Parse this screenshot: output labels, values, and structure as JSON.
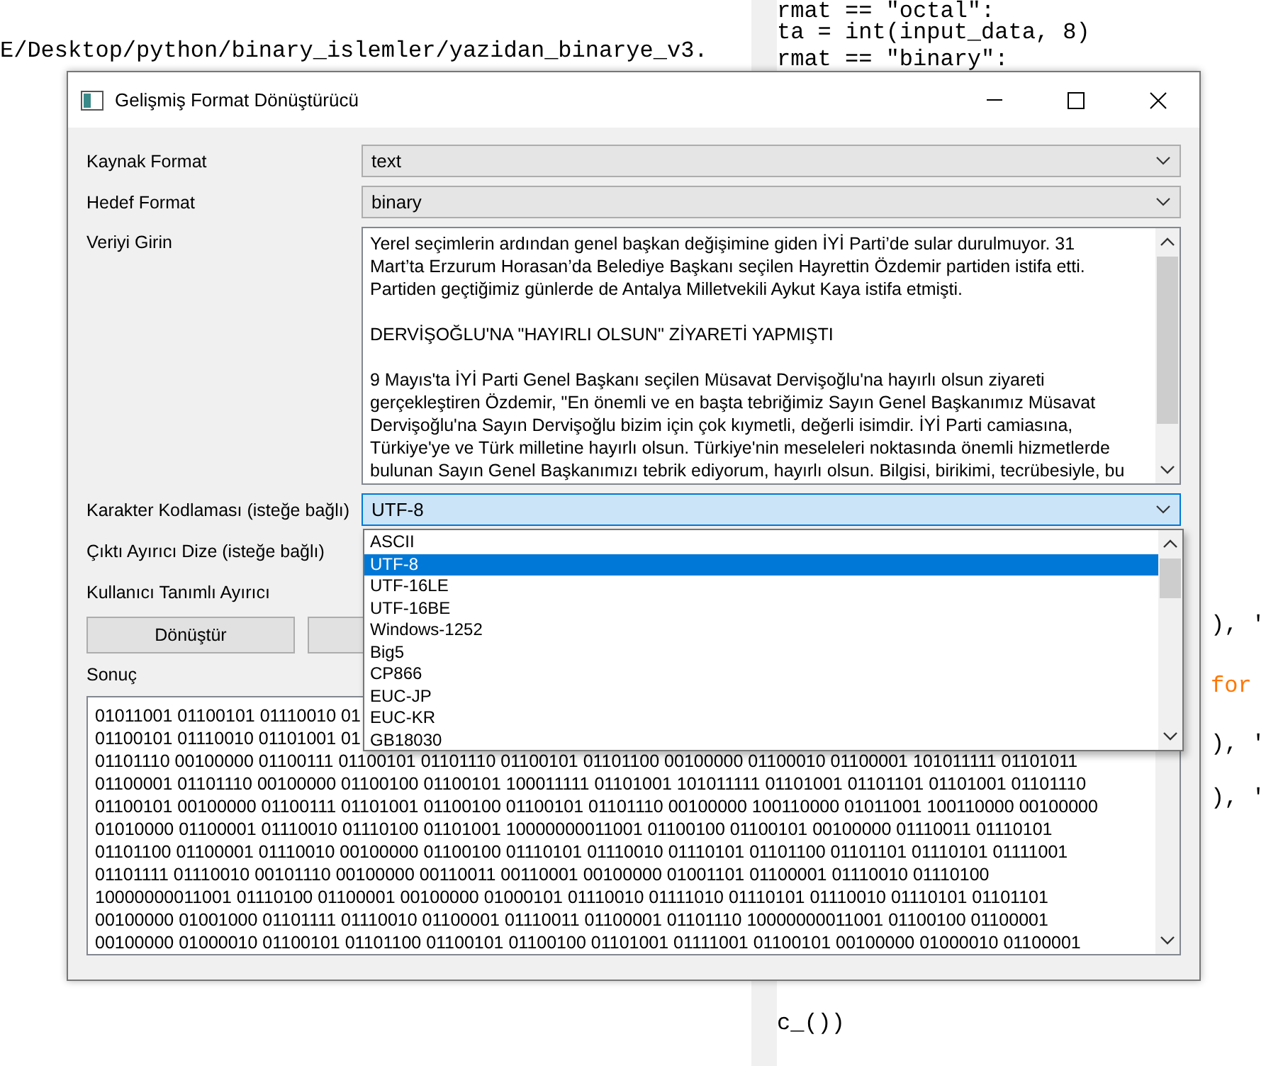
{
  "background_editor_left": {
    "lines": [
      "E/Desktop/python/binary_islemler/yazidan_binarye_v3."
    ]
  },
  "background_editor_right": {
    "lines": [
      {
        "text": "rmat == \"octal\":",
        "kind": "code"
      },
      {
        "text": "ta = int(input_data, 8)",
        "kind": "code"
      },
      {
        "text": "rmat == \"binary\":",
        "kind": "code"
      },
      {
        "text": "), '",
        "kind": "code"
      },
      {
        "text": "for",
        "kind": "keyword"
      },
      {
        "text": "), '",
        "kind": "code"
      },
      {
        "text": "), '",
        "kind": "code"
      },
      {
        "text": "c_())",
        "kind": "code"
      }
    ]
  },
  "window": {
    "title": "Gelişmiş Format Dönüştürücü",
    "fields": [
      {
        "label": "Kaynak Format",
        "kind": "combo",
        "value": "text",
        "open": false
      },
      {
        "label": "Hedef Format",
        "kind": "combo",
        "value": "binary",
        "open": false
      },
      {
        "label": "Veriyi Girin",
        "kind": "textarea",
        "paragraphs": [
          [
            "Yerel seçimlerin ardından genel başkan değişimine giden İYİ Parti’de sular durulmuyor. 31",
            "Mart’ta Erzurum Horasan’da Belediye Başkanı seçilen Hayrettin Özdemir partiden istifa etti.",
            "Partiden geçtiğimiz günlerde de Antalya Milletvekili Aykut Kaya istifa etmişti."
          ],
          [
            "DERVİŞOĞLU'NA \"HAYIRLI OLSUN\" ZİYARETİ YAPMIŞTI"
          ],
          [
            "9 Mayıs'ta İYİ Parti Genel Başkanı seçilen Müsavat Dervişoğlu'na hayırlı olsun ziyareti",
            "gerçekleştiren Özdemir, \"En önemli ve en başta tebriğimiz Sayın Genel Başkanımız Müsavat",
            "Dervişoğlu'na Sayın Dervişoğlu bizim için çok kıymetli, değerli isimdir. İYİ Parti camiasına,",
            "Türkiye'ye ve Türk milletine hayırlı olsun. Türkiye'nin meseleleri noktasında önemli hizmetlerde",
            "bulunan Sayın Genel Başkanımızı tebrik ediyorum, hayırlı olsun. Bilgisi, birikimi, tecrübesiyle, bu"
          ]
        ]
      },
      {
        "label": "Karakter Kodlaması (isteğe bağlı)",
        "kind": "combo",
        "value": "UTF-8",
        "open": true,
        "options": [
          {
            "label": "ASCII",
            "selected": false
          },
          {
            "label": "UTF-8",
            "selected": true
          },
          {
            "label": "UTF-16LE",
            "selected": false
          },
          {
            "label": "UTF-16BE",
            "selected": false
          },
          {
            "label": "Windows-1252",
            "selected": false
          },
          {
            "label": "Big5",
            "selected": false
          },
          {
            "label": "CP866",
            "selected": false
          },
          {
            "label": "EUC-JP",
            "selected": false
          },
          {
            "label": "EUC-KR",
            "selected": false
          },
          {
            "label": "GB18030",
            "selected": false
          }
        ]
      },
      {
        "label": "Çıktı Ayırıcı Dize (isteğe bağlı)",
        "kind": "hidden"
      },
      {
        "label": "Kullanıcı Tanımlı Ayırıcı",
        "kind": "hidden"
      }
    ],
    "buttons": [
      "Dönüştür"
    ],
    "result": {
      "label": "Sonuç",
      "lines": [
        "01011001 01100101 01110010 01",
        "01100101 01110010 01101001 01",
        "01101110 00100000 01100111 01100101 01101110 01100101 01101100 00100000 01100010 01100001 101011111 01101011",
        "01100001 01101110 00100000 01100100 01100101 100011111 01101001 101011111 01101001 01101101 01101001 01101110",
        "01100101 00100000 01100111 01101001 01100100 01100101 01101110 00100000 100110000 01011001 100110000 00100000",
        "01010000 01100001 01110010 01110100 01101001 10000000011001 01100100 01100101 00100000 01110011 01110101",
        "01101100 01100001 01110010 00100000 01100100 01110101 01110010 01110101 01101100 01101101 01110101 01111001",
        "01101111 01110010 00101110 00100000 00110011 00110001 00100000 01001101 01100001 01110010 01110100",
        "10000000011001 01110100 01100001 00100000 01000101 01110010 01111010 01110101 01110010 01110101 01101101",
        "00100000 01001000 01101111 01110010 01100001 01110011 01100001 01101110 10000000011001 01100100 01100001",
        "00100000 01000010 01100101 01101100 01100101 01100100 01101001 01111001 01100101 00100000 01000010 01100001"
      ]
    }
  }
}
